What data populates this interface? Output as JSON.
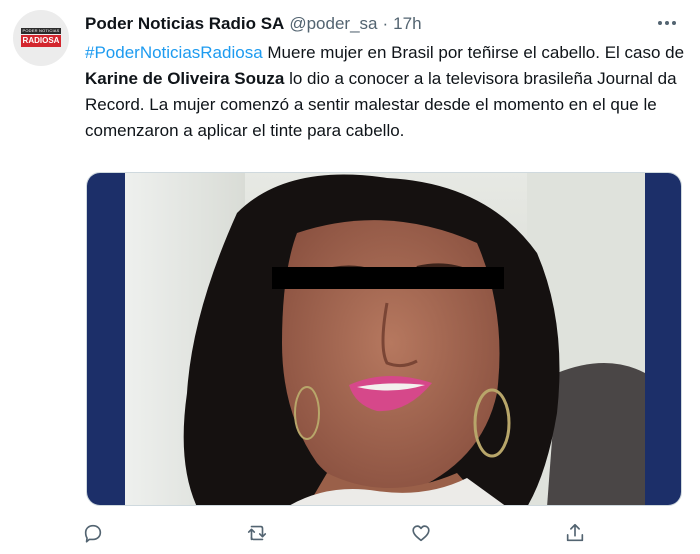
{
  "account": {
    "name": "Poder Noticias Radio SA",
    "handle": "@poder_sa",
    "separator": "·",
    "time": "17h",
    "avatar_logo_top": "PODER NOTICIAS",
    "avatar_logo_main": "RADIOSA"
  },
  "tweet": {
    "hashtag": "#PoderNoticiasRadiosa",
    "text_part1": " Muere mujer en Brasil por teñirse el cabello. El caso de ",
    "person": "Karine de Oliveira Souza",
    "text_part2": " lo dio a conocer a la televisora brasileña Journal da Record. La mujer comenzó a sentir malestar desde el momento en el que le comenzaron a aplicar el tinte para cabello."
  },
  "media": {
    "description_icon": "photo-of-woman-with-censored-eyes"
  },
  "actions": {
    "icons": [
      "reply-icon",
      "retweet-icon",
      "like-icon",
      "share-icon"
    ]
  },
  "colors": {
    "link": "#1d9bf0",
    "secondary_text": "#536471",
    "border": "#cfd9de"
  }
}
